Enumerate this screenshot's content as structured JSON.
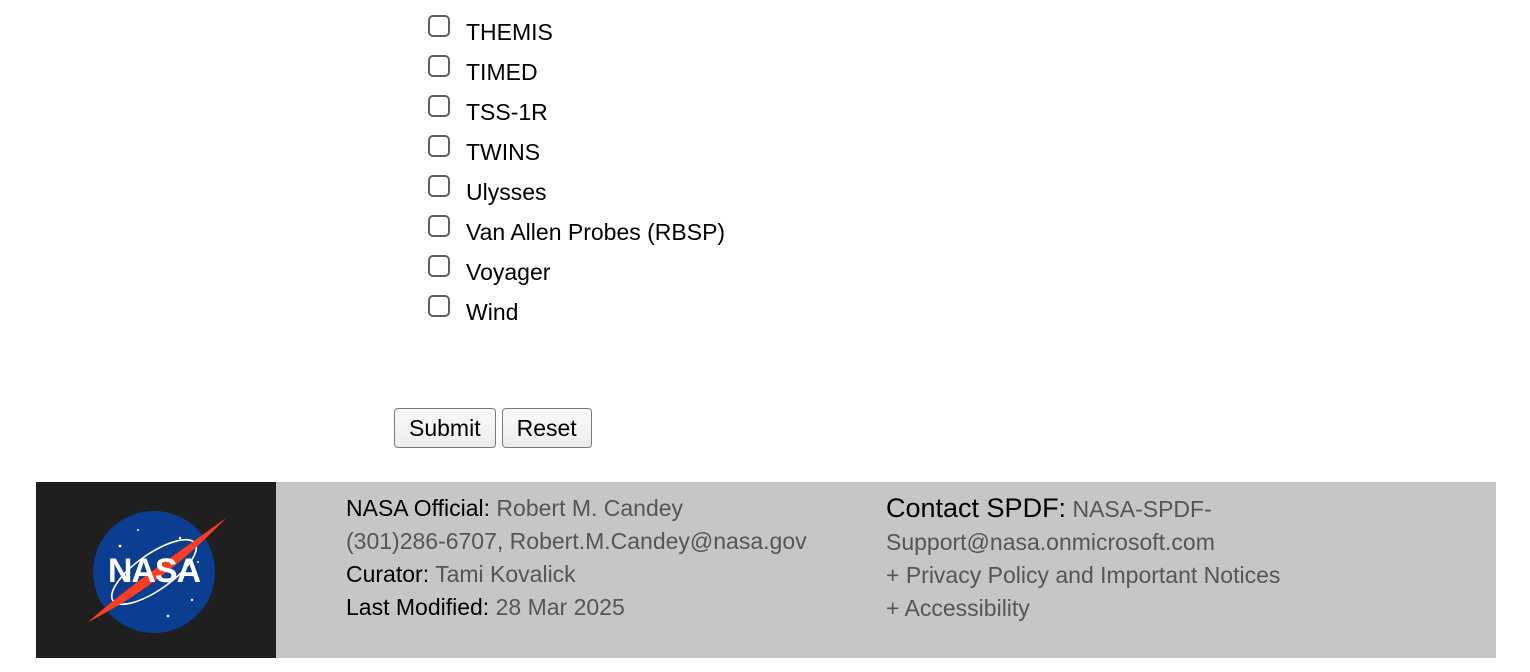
{
  "mission_checklist": {
    "items": [
      {
        "label": "THEMIS",
        "checked": false
      },
      {
        "label": "TIMED",
        "checked": false
      },
      {
        "label": "TSS-1R",
        "checked": false
      },
      {
        "label": "TWINS",
        "checked": false
      },
      {
        "label": "Ulysses",
        "checked": false
      },
      {
        "label": "Van Allen Probes (RBSP)",
        "checked": false
      },
      {
        "label": "Voyager",
        "checked": false
      },
      {
        "label": "Wind",
        "checked": false
      }
    ]
  },
  "form_buttons": {
    "submit_label": "Submit",
    "reset_label": "Reset"
  },
  "footer": {
    "logo": {
      "icon": "nasa-meatball-logo",
      "text": "NASA",
      "colors": {
        "circle": "#0b3d91",
        "swoosh": "#fc3d21"
      }
    },
    "official_label": "NASA Official:",
    "official_name": "Robert M. Candey",
    "official_contact": "(301)286-6707, Robert.M.Candey@nasa.gov",
    "curator_label": "Curator:",
    "curator_name": "Tami Kovalick",
    "modified_label": "Last Modified:",
    "modified_date": "28 Mar 2025",
    "contact_label": "Contact SPDF:",
    "contact_email_line1": "NASA-SPDF-",
    "contact_email_line2": "Support@nasa.onmicrosoft.com",
    "privacy_link": "+ Privacy Policy and Important Notices",
    "accessibility_link": "+ Accessibility"
  }
}
